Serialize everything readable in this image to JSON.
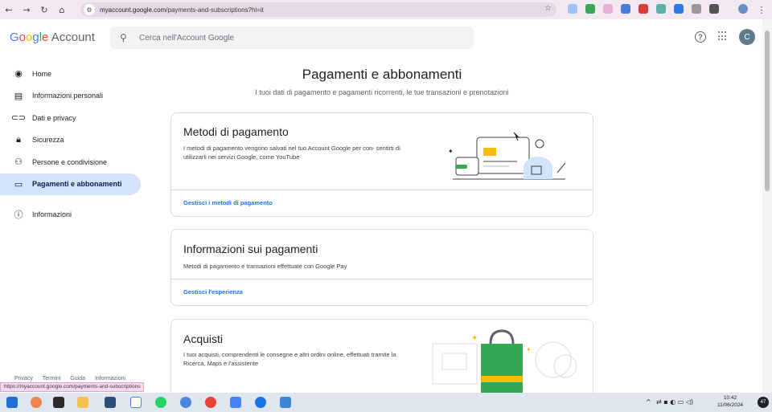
{
  "browser": {
    "url_host": "myaccount.google.com",
    "url_path": "/payments-and-subscriptions?hl=it"
  },
  "header": {
    "logo_google": [
      "G",
      "o",
      "o",
      "g",
      "l",
      "e"
    ],
    "logo_account": "Account",
    "search_placeholder": "Cerca nell'Account Google",
    "avatar_letter": "C"
  },
  "sidebar": {
    "items": [
      {
        "label": "Home",
        "icon": "home-icon"
      },
      {
        "label": "Informazioni personali",
        "icon": "id-card-icon"
      },
      {
        "label": "Dati e privacy",
        "icon": "toggle-icon"
      },
      {
        "label": "Sicurezza",
        "icon": "lock-icon"
      },
      {
        "label": "Persone e condivisione",
        "icon": "people-icon"
      },
      {
        "label": "Pagamenti e abbonamenti",
        "icon": "card-icon"
      },
      {
        "label": "Informazioni",
        "icon": "info-icon"
      }
    ]
  },
  "main": {
    "title": "Pagamenti e abbonamenti",
    "subtitle": "I tuoi dati di pagamento e pagamenti ricorrenti, le tue transazioni e prenotazioni",
    "cards": [
      {
        "title": "Metodi di pagamento",
        "description": "I metodi di pagamento vengono salvati nel tuo Account Google per con- sentirti di utilizzarli nei servizi Google, come YouTube",
        "link": "Gestisci i metodi di pagamento"
      },
      {
        "title": "Informazioni sui pagamenti",
        "description": "Metodi di pagamento e transazioni effettuate con Google Pay",
        "link": "Gestisci l'esperienza"
      },
      {
        "title": "Acquisti",
        "description": "I tuoi acquisti, comprendenti le consegne e altri ordini online, effettuati tramite la Ricerca, Maps e l'assistente"
      }
    ]
  },
  "footer": {
    "links": [
      "Privacy",
      "Termini",
      "Guida",
      "Informazioni"
    ],
    "status_url": "https://myaccount.google.com/payments-and-subscriptions"
  },
  "taskbar": {
    "time": "10:42",
    "date": "11/06/2024",
    "notifications": "47"
  }
}
